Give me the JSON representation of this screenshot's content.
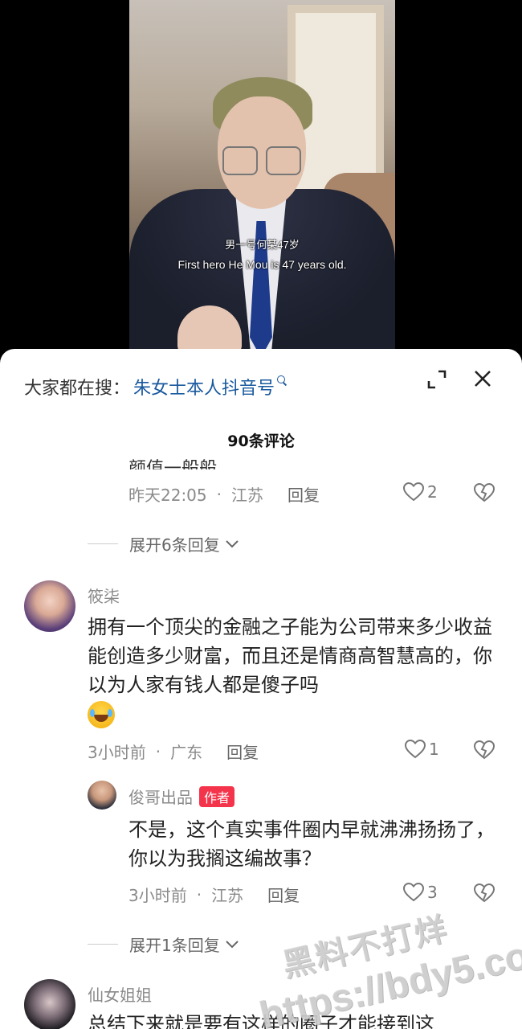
{
  "video": {
    "caption_cn": "男一号何某47岁",
    "caption_en": "First hero He Mou is 47 years old."
  },
  "sheet": {
    "search_prefix": "大家都在搜：",
    "search_term": "朱女士本人抖音号",
    "comment_count_label": "90条评论"
  },
  "comments": [
    {
      "clipped_text": "颜值一般般",
      "time": "昨天22:05",
      "location": "江苏",
      "reply_label": "回复",
      "likes": "2",
      "expand_label": "展开6条回复"
    },
    {
      "username": "筱柒",
      "text": "拥有一个顶尖的金融之子能为公司带来多少收益能创造多少财富，而且还是情商高智慧高的，你以为人家有钱人都是傻子吗",
      "emoji": "laughing-crying-emoji",
      "time": "3小时前",
      "location": "广东",
      "reply_label": "回复",
      "likes": "1",
      "replies": [
        {
          "username": "俊哥出品",
          "badge": "作者",
          "text": "不是，这个真实事件圈内早就沸沸扬扬了，你以为我搁这编故事？",
          "time": "3小时前",
          "location": "江苏",
          "reply_label": "回复",
          "likes": "3"
        }
      ],
      "expand_label": "展开1条回复"
    },
    {
      "username": "仙女姐姐",
      "text": "总结下来就是要有这样的圈子才能接到这"
    }
  ],
  "watermark": {
    "line1": "黑料不打烊",
    "line2": "https://bdy5.co"
  },
  "colors": {
    "link_blue": "#19599e",
    "author_badge": "#f4344b",
    "meta_gray": "#8a8a8a"
  },
  "icons": [
    "expand-icon",
    "close-icon",
    "heart-icon",
    "dislike-icon",
    "chevron-down-icon",
    "search-glyph-icon"
  ]
}
